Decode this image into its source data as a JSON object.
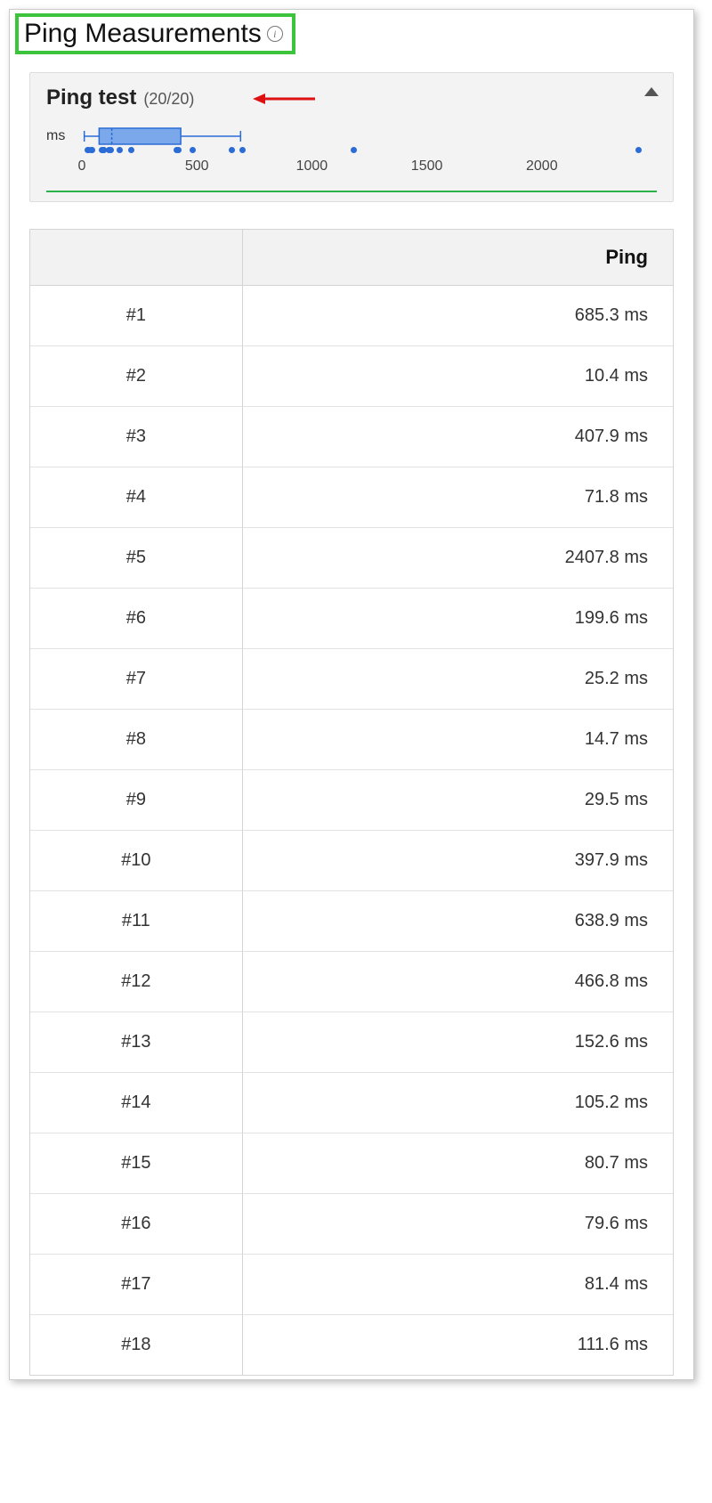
{
  "header": {
    "title": "Ping Measurements",
    "info_glyph": "i"
  },
  "subheader": {
    "title": "Ping test",
    "count_label": "(20/20)"
  },
  "chart_data": {
    "type": "boxplot",
    "unit_label": "ms",
    "ticks": [
      0,
      500,
      1000,
      1500,
      2000
    ],
    "range": [
      0,
      2500
    ],
    "box": {
      "min": 10.4,
      "q1": 75,
      "median": 130,
      "q3": 430,
      "max": 690
    },
    "points": [
      10.4,
      14.7,
      25.2,
      29.5,
      71.8,
      79.6,
      80.7,
      81.4,
      105.2,
      111.6,
      152.6,
      199.6,
      397.9,
      407.9,
      466.8,
      638.9,
      685.3,
      1170,
      2407.8
    ]
  },
  "table": {
    "headers": [
      "",
      "Ping"
    ],
    "unit": "ms",
    "rows": [
      {
        "label": "#1",
        "value": "685.3 ms"
      },
      {
        "label": "#2",
        "value": "10.4 ms"
      },
      {
        "label": "#3",
        "value": "407.9 ms"
      },
      {
        "label": "#4",
        "value": "71.8 ms"
      },
      {
        "label": "#5",
        "value": "2407.8 ms"
      },
      {
        "label": "#6",
        "value": "199.6 ms"
      },
      {
        "label": "#7",
        "value": "25.2 ms"
      },
      {
        "label": "#8",
        "value": "14.7 ms"
      },
      {
        "label": "#9",
        "value": "29.5 ms"
      },
      {
        "label": "#10",
        "value": "397.9 ms"
      },
      {
        "label": "#11",
        "value": "638.9 ms"
      },
      {
        "label": "#12",
        "value": "466.8 ms"
      },
      {
        "label": "#13",
        "value": "152.6 ms"
      },
      {
        "label": "#14",
        "value": "105.2 ms"
      },
      {
        "label": "#15",
        "value": "80.7 ms"
      },
      {
        "label": "#16",
        "value": "79.6 ms"
      },
      {
        "label": "#17",
        "value": "81.4 ms"
      },
      {
        "label": "#18",
        "value": "111.6 ms"
      }
    ]
  }
}
